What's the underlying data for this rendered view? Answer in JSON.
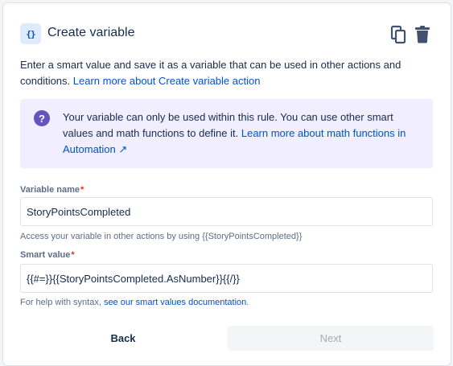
{
  "header": {
    "icon_glyph": "{}",
    "title": "Create variable",
    "icons": [
      "copy-icon",
      "trash-icon"
    ]
  },
  "description": {
    "text": "Enter a smart value and save it as a variable that can be used in other actions and conditions. ",
    "link": "Learn more about Create variable action"
  },
  "info": {
    "icon_glyph": "?",
    "text": "Your variable can only be used within this rule. You can use other smart values and math functions to define it. ",
    "link": "Learn more about math functions in Automation",
    "link_arrow": "↗"
  },
  "variable_name": {
    "label": "Variable name",
    "required_mark": "*",
    "value": "StoryPointsCompleted",
    "help": "Access your variable in other actions by using {{StoryPointsCompleted}}"
  },
  "smart_value": {
    "label": "Smart value",
    "required_mark": "*",
    "value": "{{#=}}{{StoryPointsCompleted.AsNumber}}{{/}}",
    "help_prefix": "For help with syntax, ",
    "help_link": "see our smart values documentation",
    "help_suffix": "."
  },
  "buttons": {
    "back": "Back",
    "next": "Next"
  },
  "colors": {
    "accent": "#0052cc",
    "info_bg": "#f0eeff",
    "info_icon": "#6554c0",
    "required": "#de350b"
  }
}
